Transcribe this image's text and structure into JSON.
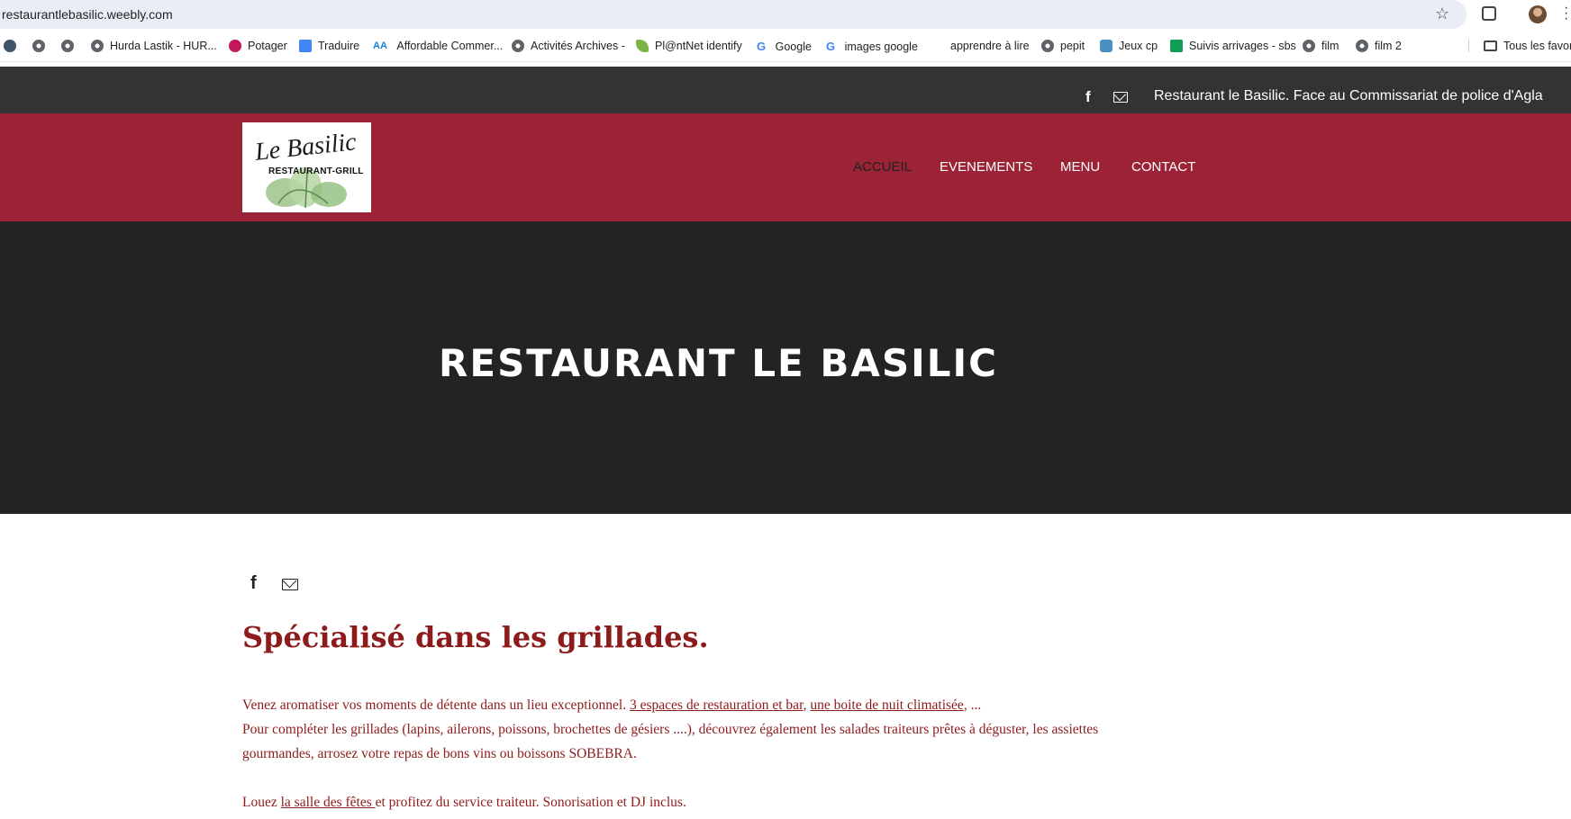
{
  "browser": {
    "url": "restaurantlebasilic.weebly.com",
    "bookmarks": [
      {
        "label": "",
        "icon": "wordpress-icon"
      },
      {
        "label": "",
        "icon": "globe-icon"
      },
      {
        "label": "",
        "icon": "globe-icon"
      },
      {
        "label": "Hurda Lastik - HUR...",
        "icon": "globe-icon"
      },
      {
        "label": "Potager",
        "icon": "radish-icon"
      },
      {
        "label": "Traduire",
        "icon": "translate-icon"
      },
      {
        "label": "Affordable Commer...",
        "icon": "aa-icon"
      },
      {
        "label": "Activités Archives -",
        "icon": "globe-icon"
      },
      {
        "label": "Pl@ntNet identify",
        "icon": "plant-icon"
      },
      {
        "label": "Google",
        "icon": "google-icon"
      },
      {
        "label": "images google",
        "icon": "google-icon"
      },
      {
        "label": "apprendre à lire",
        "icon": ""
      },
      {
        "label": "pepit",
        "icon": "globe-icon"
      },
      {
        "label": "Jeux cp",
        "icon": "game-icon"
      },
      {
        "label": "Suivis arrivages - sbs",
        "icon": "sheets-icon"
      },
      {
        "label": "film",
        "icon": "globe-icon"
      },
      {
        "label": "film 2",
        "icon": "globe-icon"
      },
      {
        "label": "Tous les favor",
        "icon": "folder-icon"
      }
    ]
  },
  "topbar": {
    "text": "Restaurant le Basilic. Face au Commissariat de police d'Agla",
    "facebook_icon": "f"
  },
  "header": {
    "logo_title": "Le Basilic",
    "logo_subtitle": "RESTAURANT-GRILL",
    "nav": [
      "ACCUEIL",
      "EVENEMENTS",
      "MENU",
      "CONTACT"
    ],
    "active_nav": "ACCUEIL",
    "brand_color": "#9b2335"
  },
  "hero": {
    "title": "RESTAURANT LE BASILIC"
  },
  "content": {
    "facebook_icon": "f",
    "headline": "Spécialisé dans les grillades.",
    "p1_text": "Venez aromatiser vos moments de détente dans un lieu exceptionnel. ",
    "p1_link1": "3 espaces de restauration et bar",
    "p1_sep": ", ",
    "p1_link2": "une boite de nuit climatisée",
    "p1_end": ", ...",
    "p2_line1": "Pour compléter les grillades (lapins, ailerons, poissons, brochettes de gésiers ....), découvrez également les salades traiteurs prêtes à déguster, les assiettes",
    "p2_line2": "gourmandes, arrosez votre repas de bons vins ou boissons SOBEBRA.",
    "p3_start": "Louez ",
    "p3_link": "la salle des fêtes ",
    "p3_end": "et profitez du service traiteur. Sonorisation et DJ inclus.",
    "text_color": "#8e1b1b"
  }
}
